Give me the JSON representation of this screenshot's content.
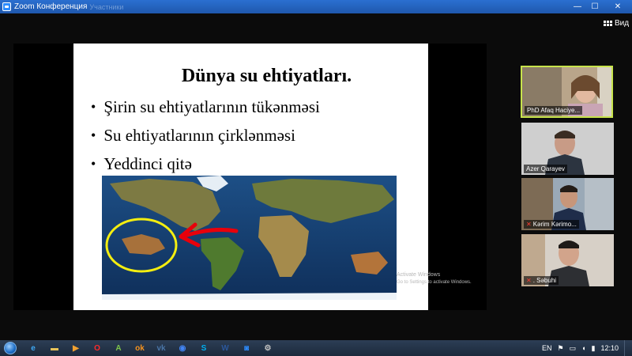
{
  "window": {
    "title": "Zoom Конференция",
    "title_ghost": "Участники",
    "minimize_label": "—",
    "maximize_label": "☐",
    "close_label": "✕"
  },
  "toolbar": {
    "view_label": "Вид"
  },
  "slide": {
    "title": "Dünya su ehtiyatları.",
    "bullets": [
      "Şirin su ehtiyatlarının tükənməsi",
      "Su ehtiyatlarının çirklənməsi",
      "Yeddinci qitə"
    ],
    "bullet_glyph": "•"
  },
  "watermark": {
    "line1": "Activate Windows",
    "line2": "Go to Settings to activate Windows."
  },
  "participants": [
    {
      "name": "PhD Afaq Haciye...",
      "muted": false,
      "active": true
    },
    {
      "name": "Azer Qarayev",
      "muted": false,
      "active": false
    },
    {
      "name": "Kərim Kərimo...",
      "muted": true,
      "active": false
    },
    {
      "name": ". Səbuhi",
      "muted": true,
      "active": false
    }
  ],
  "taskbar": {
    "apps": [
      {
        "icon": "ie-icon",
        "glyph": "e",
        "color": "#3fa9f5"
      },
      {
        "icon": "folder-icon",
        "glyph": "▬",
        "color": "#e8c35a"
      },
      {
        "icon": "media-player-icon",
        "glyph": "▶",
        "color": "#f0a030"
      },
      {
        "icon": "opera-icon",
        "glyph": "O",
        "color": "#ff2a2a"
      },
      {
        "icon": "android-icon",
        "glyph": "A",
        "color": "#7cc34a"
      },
      {
        "icon": "odnoklassniki-icon",
        "glyph": "ok",
        "color": "#f7931e"
      },
      {
        "icon": "vk-icon",
        "glyph": "vk",
        "color": "#4a76a8"
      },
      {
        "icon": "chrome-icon",
        "glyph": "◉",
        "color": "#4285f4"
      },
      {
        "icon": "skype-icon",
        "glyph": "S",
        "color": "#00aff0"
      },
      {
        "icon": "word-icon",
        "glyph": "W",
        "color": "#2b579a"
      },
      {
        "icon": "zoom-icon",
        "glyph": "◙",
        "color": "#2d8cff"
      },
      {
        "icon": "tool-icon",
        "glyph": "⚙",
        "color": "#c0c0c0"
      }
    ],
    "language": "EN",
    "clock": "12:10"
  },
  "colors": {
    "title_bar": "#2567c4",
    "active_speaker_border": "#c7e34b",
    "annotation_red": "#e8000b",
    "annotation_yellow": "#f4ee10"
  }
}
